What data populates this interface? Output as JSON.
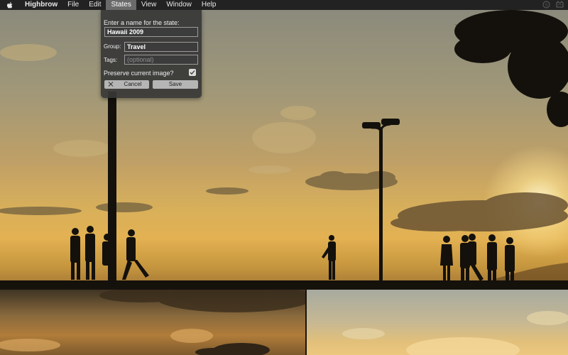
{
  "menubar": {
    "apple_icon": "apple-icon",
    "items": [
      {
        "label": "Highbrow",
        "app": true
      },
      {
        "label": "File"
      },
      {
        "label": "Edit"
      },
      {
        "label": "States",
        "active": true
      },
      {
        "label": "View"
      },
      {
        "label": "Window"
      },
      {
        "label": "Help"
      }
    ],
    "status_icons": [
      "skype-icon",
      "cat-icon"
    ]
  },
  "states_dialog": {
    "prompt": "Enter a name for the state:",
    "name_value": "Hawaii 2009",
    "group_label": "Group:",
    "group_value": "Travel",
    "tags_label": "Tags:",
    "tags_placeholder": "(optional)",
    "preserve_label": "Preserve current image?",
    "preserve_checked": true,
    "cancel_label": "Cancel",
    "save_label": "Save"
  },
  "colors": {
    "menubar_bg": "#222222",
    "active_menu": "#6a6a6a",
    "popover_bg": "#373737"
  }
}
